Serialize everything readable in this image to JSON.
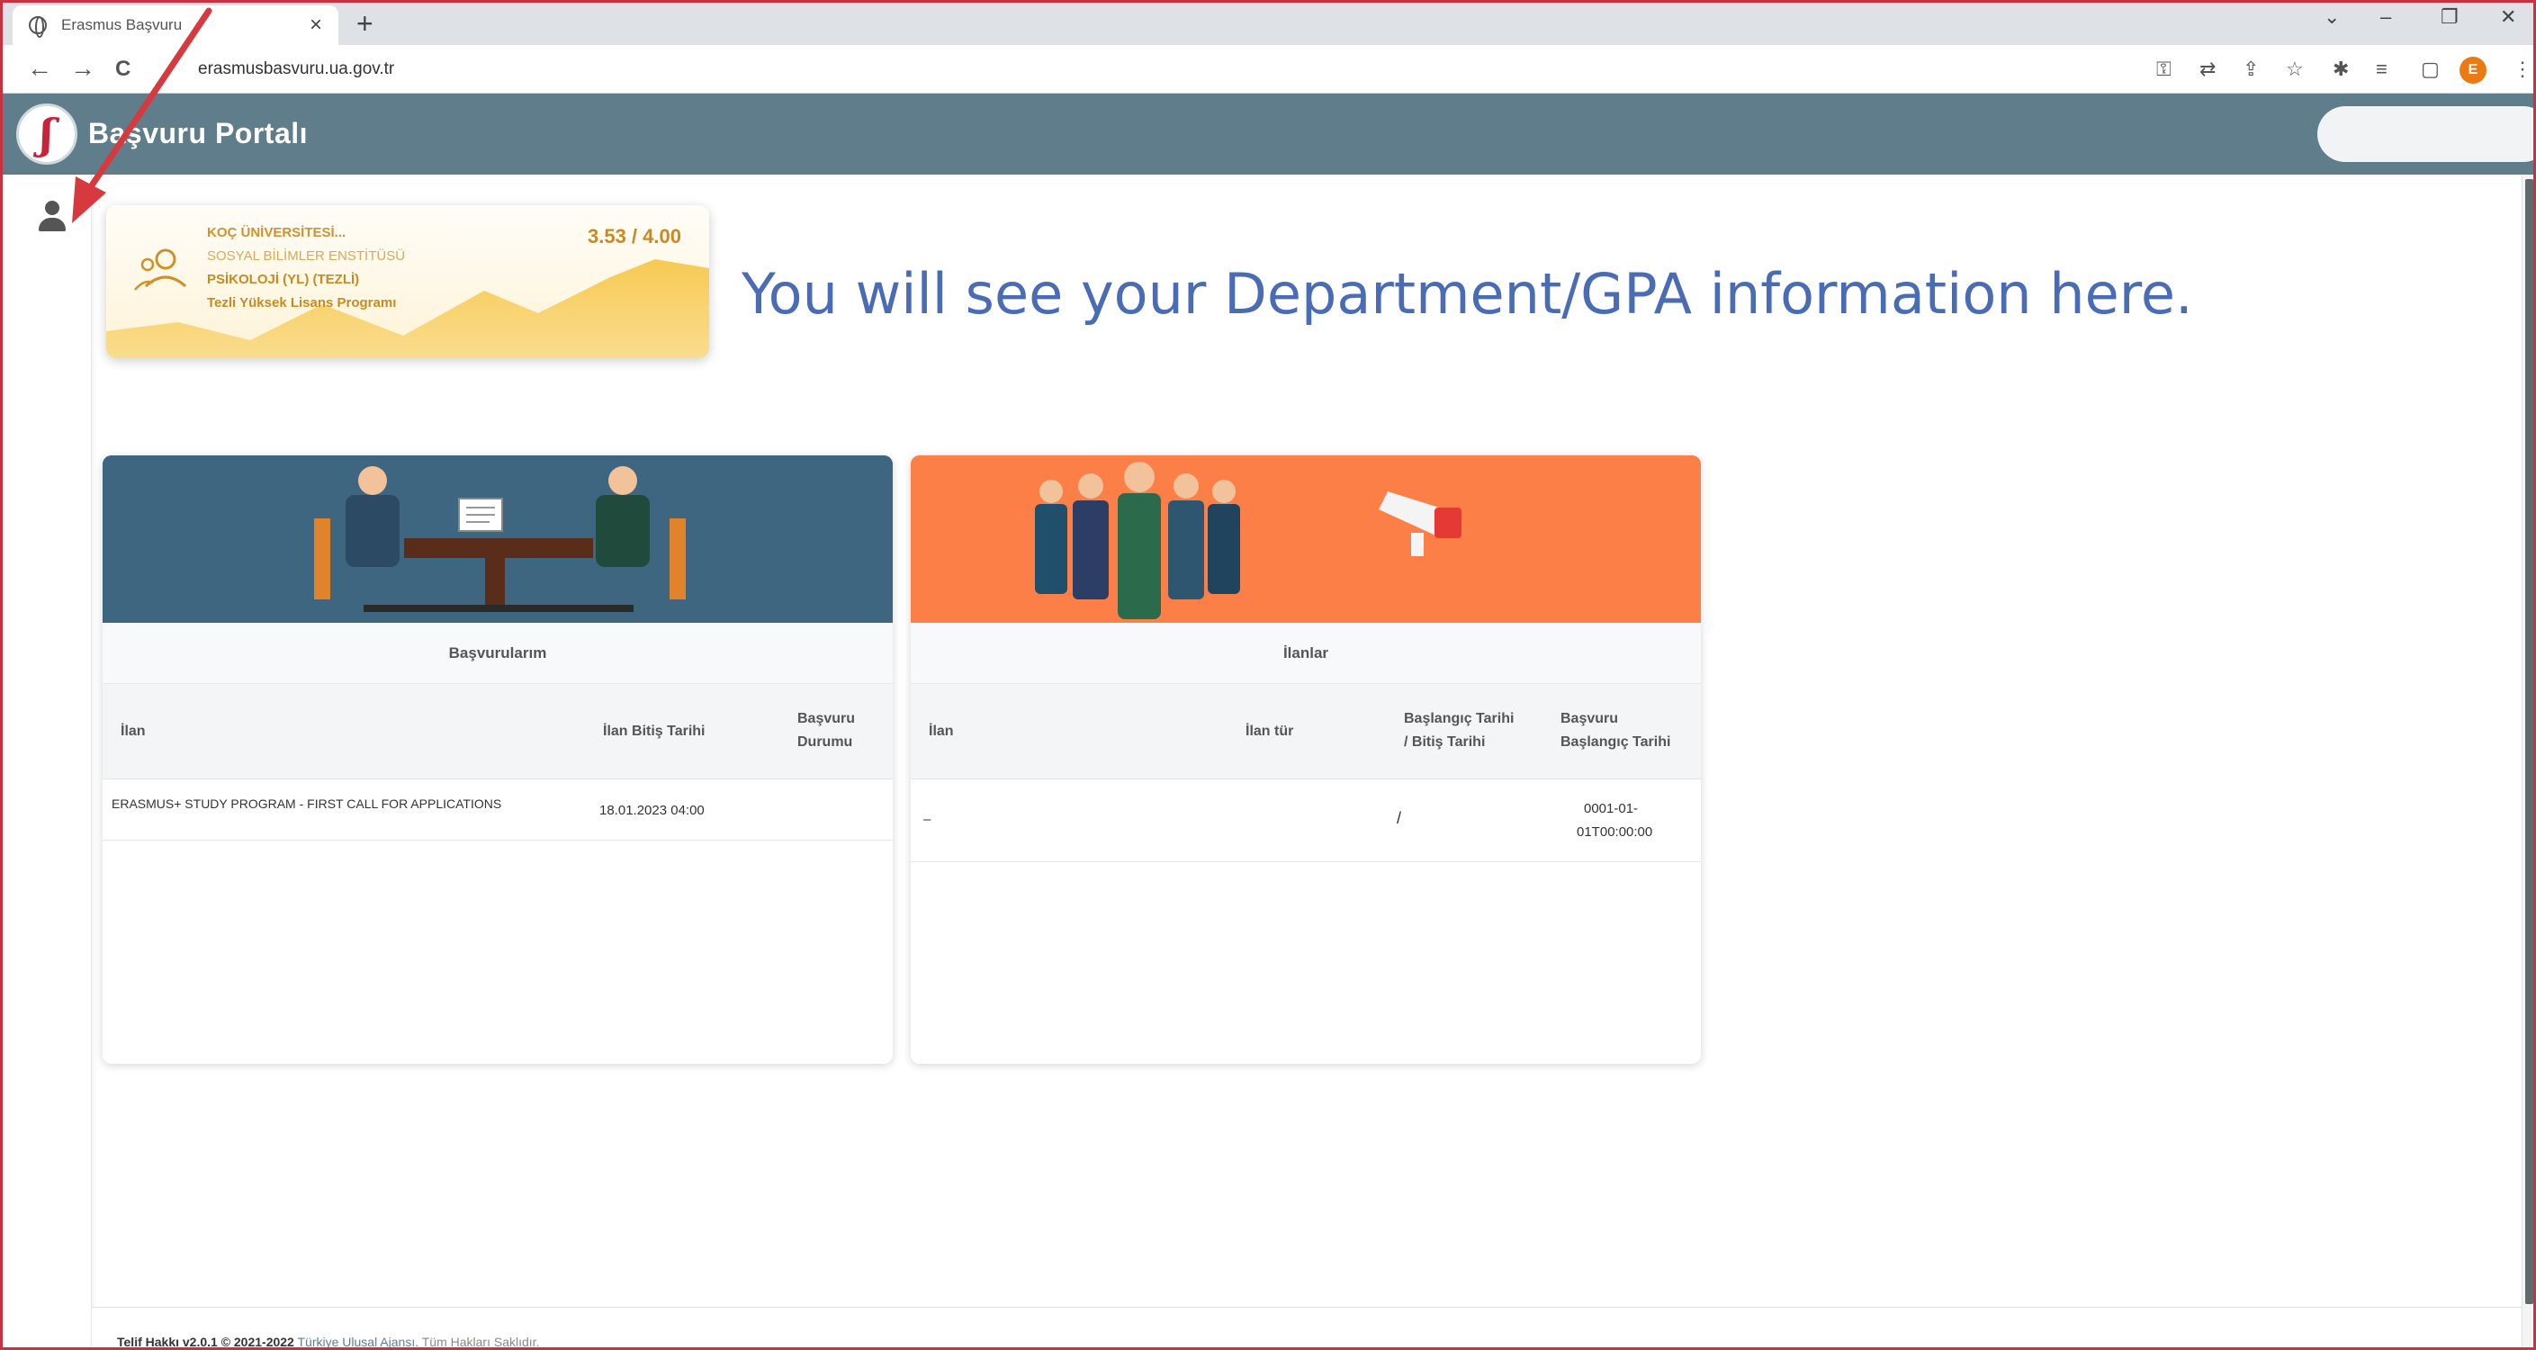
{
  "browser": {
    "tab_title": "Erasmus Başvuru",
    "tab_close": "×",
    "new_tab": "+",
    "url": "erasmusbasvuru.ua.gov.tr",
    "back": "←",
    "forward": "→",
    "reload": "C",
    "window_controls": {
      "dropdown": "⌄",
      "minimize": "–",
      "restore": "❐",
      "close": "✕"
    },
    "toolbar_icons": [
      "key-icon",
      "translate-icon",
      "share-icon",
      "star-icon",
      "extensions-icon",
      "reading-list-icon",
      "sidepanel-icon"
    ],
    "profile_initial": "E",
    "menu": "⋮"
  },
  "header": {
    "logo_glyph": "ʃ",
    "title": "Başvuru Portalı"
  },
  "gpa_card": {
    "line1": "KOÇ ÜNİVERSİTESİ...",
    "line2": "SOSYAL BİLİMLER ENSTİTÜSÜ",
    "line3": "PSİKOLOJİ (YL) (TEZLİ)",
    "line4": "Tezli Yüksek Lisans Programı",
    "gpa": "3.53 / 4.00"
  },
  "annotation": "You will see your Department/GPA information here.",
  "applications": {
    "title": "Başvurularım",
    "columns": [
      "İlan",
      "İlan Bitiş Tarihi",
      "Başvuru",
      "Durumu"
    ],
    "rows": [
      {
        "ilan": "ERASMUS+ STUDY PROGRAM - FIRST CALL FOR APPLICATIONS",
        "bitis": "18.01.2023 04:00",
        "durum": ""
      }
    ]
  },
  "announcements": {
    "title": "İlanlar",
    "columns": [
      "İlan",
      "İlan tür",
      "Başlangıç Tarihi",
      "/ Bitiş Tarihi",
      "Başvuru",
      "Başlangıç Tarihi"
    ],
    "rows": [
      {
        "ilan": "–",
        "tur": "",
        "tarih": "/",
        "basvuru_line1": "0001-01-",
        "basvuru_line2": "01T00:00:00"
      }
    ]
  },
  "footer": {
    "copyright": "Telif Hakkı v2.0.1 © 2021-2022",
    "agency": "Türkiye Ulusal Ajansı.",
    "rights": "Tüm Hakları Saklıdır."
  },
  "colors": {
    "header_bg": "#5f7d8a",
    "frame": "#c8313f",
    "annotation": "#4a6cb4",
    "banner_blue": "#3f6680",
    "banner_orange": "#fd7f48",
    "gpa_gold": "#c98a22"
  }
}
